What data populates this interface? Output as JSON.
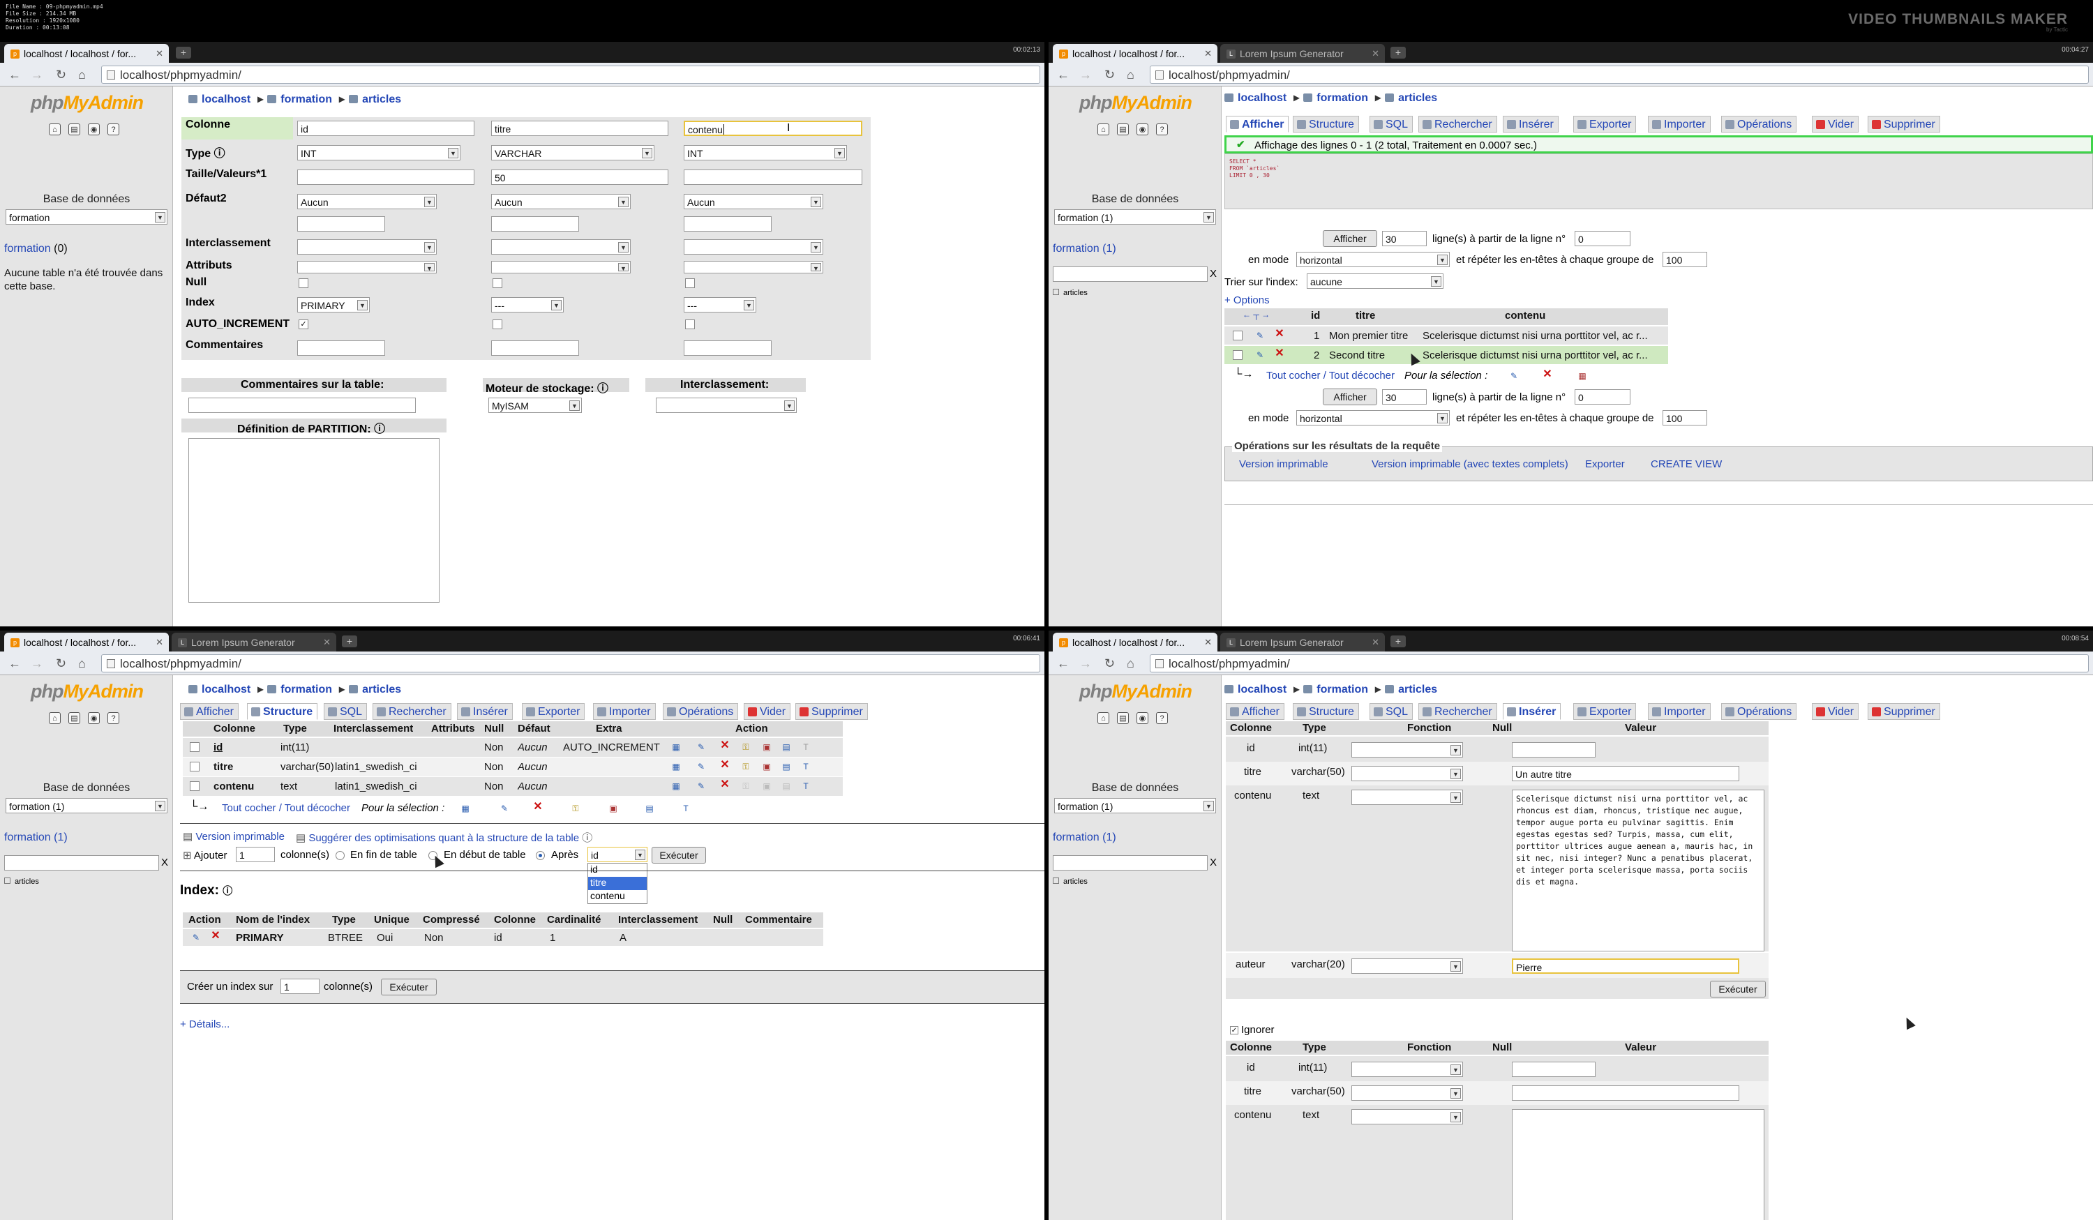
{
  "file_meta": [
    "File Name   : 09-phpmyadmin.mp4",
    "File Size   : 214.34 MB",
    "Resolution  : 1920x1080",
    "Duration    : 00:13:08"
  ],
  "watermark": {
    "title": "VIDEO THUMBNAILS MAKER",
    "sub": "by Tactic"
  },
  "common": {
    "url": "localhost/phpmyadmin/",
    "tab_main": "localhost / localhost / for...",
    "tab_lorem": "Lorem Ipsum Generator",
    "logo_php": "php",
    "logo_my": "MyAdmin",
    "base_label": "Base de données",
    "crumb_server": "localhost",
    "crumb_db": "formation",
    "crumb_table": "articles",
    "nav_tabs": [
      "Afficher",
      "Structure",
      "SQL",
      "Rechercher",
      "Insérer",
      "Exporter",
      "Importer",
      "Opérations",
      "Vider",
      "Supprimer"
    ]
  },
  "p1": {
    "time": "00:02:13",
    "db_select": "formation",
    "db_link": "formation",
    "db_count": "(0)",
    "no_table": "Aucune table n'a été trouvée dans cette base.",
    "labels": {
      "colonne": "Colonne",
      "type": "Type",
      "taille": "Taille/Valeurs*1",
      "defaut": "Défaut2",
      "interclassement": "Interclassement",
      "attributs": "Attributs",
      "null": "Null",
      "index": "Index",
      "auto": "AUTO_INCREMENT",
      "commentaires": "Commentaires"
    },
    "columns": [
      {
        "name": "id",
        "type": "INT",
        "size": "",
        "default": "Aucun",
        "index": "PRIMARY",
        "auto": true
      },
      {
        "name": "titre",
        "type": "VARCHAR",
        "size": "50",
        "default": "Aucun",
        "index": "---",
        "auto": false
      },
      {
        "name": "contenu",
        "type": "INT",
        "size": "",
        "default": "Aucun",
        "index": "---",
        "auto": false
      }
    ],
    "table_comments_label": "Commentaires sur la table:",
    "engine_label": "Moteur de stockage:",
    "engine_value": "MyISAM",
    "collation_label": "Interclassement:",
    "partition_label": "Définition de PARTITION:"
  },
  "p2": {
    "time": "00:04:27",
    "db_select": "formation (1)",
    "db_link": "formation (1)",
    "side_table": "articles",
    "success": "Affichage des lignes 0 - 1 (2 total, Traitement en 0.0007 sec.)",
    "sql": "SELECT *\nFROM `articles`\nLIMIT 0 , 30",
    "afficher_btn": "Afficher",
    "rows_count": "30",
    "from_label": "ligne(s) à partir de la ligne n°",
    "from_value": "0",
    "mode_label": "en mode",
    "mode_value": "horizontal",
    "repeat_label": "et répéter les en-têtes à chaque groupe de",
    "repeat_value": "100",
    "sort_label": "Trier sur l'index:",
    "sort_value": "aucune",
    "options_link": "+ Options",
    "grid_headers": [
      "id",
      "titre",
      "contenu"
    ],
    "rows": [
      {
        "id": "1",
        "titre": "Mon premier titre",
        "contenu": "Scelerisque dictumst nisi urna porttitor vel, ac r..."
      },
      {
        "id": "2",
        "titre": "Second titre",
        "contenu": "Scelerisque dictumst nisi urna porttitor vel, ac r..."
      }
    ],
    "check_all": "Tout cocher / Tout décocher",
    "for_selection": "Pour la sélection :",
    "ops_title": "Opérations sur les résultats de la requête",
    "ops": [
      "Version imprimable",
      "Version imprimable (avec textes complets)",
      "Exporter",
      "CREATE VIEW"
    ]
  },
  "p3": {
    "time": "00:06:41",
    "db_select": "formation (1)",
    "db_link": "formation (1)",
    "side_table": "articles",
    "headers": [
      "Colonne",
      "Type",
      "Interclassement",
      "Attributs",
      "Null",
      "Défaut",
      "Extra",
      "Action"
    ],
    "rows": [
      {
        "col": "id",
        "type": "int(11)",
        "coll": "",
        "attr": "",
        "null": "Non",
        "def": "Aucun",
        "extra": "AUTO_INCREMENT"
      },
      {
        "col": "titre",
        "type": "varchar(50)",
        "coll": "latin1_swedish_ci",
        "attr": "",
        "null": "Non",
        "def": "Aucun",
        "extra": ""
      },
      {
        "col": "contenu",
        "type": "text",
        "coll": "latin1_swedish_ci",
        "attr": "",
        "null": "Non",
        "def": "Aucun",
        "extra": ""
      }
    ],
    "check_all": "Tout cocher / Tout décocher",
    "for_selection": "Pour la sélection :",
    "print_link": "Version imprimable",
    "suggest_link": "Suggérer des optimisations quant à la structure de la table",
    "add_label": "Ajouter",
    "add_value": "1",
    "cols_label": "colonne(s)",
    "end_label": "En fin de table",
    "start_label": "En début de table",
    "after_label": "Après",
    "after_value": "id",
    "after_options": [
      "id",
      "titre",
      "contenu"
    ],
    "exec_btn": "Exécuter",
    "index_title": "Index:",
    "index_headers": [
      "Action",
      "Nom de l'index",
      "Type",
      "Unique",
      "Compressé",
      "Colonne",
      "Cardinalité",
      "Interclassement",
      "Null",
      "Commentaire"
    ],
    "index_row": [
      "PRIMARY",
      "BTREE",
      "Oui",
      "Non",
      "id",
      "1",
      "A",
      ""
    ],
    "create_index": "Créer un index sur",
    "create_value": "1",
    "create_cols": "colonne(s)",
    "details": "+ Détails..."
  },
  "p4": {
    "time": "00:08:54",
    "db_select": "formation (1)",
    "db_link": "formation (1)",
    "side_table": "articles",
    "headers": [
      "Colonne",
      "Type",
      "Fonction",
      "Null",
      "Valeur"
    ],
    "rows": [
      {
        "col": "id",
        "type": "int(11)",
        "value": ""
      },
      {
        "col": "titre",
        "type": "varchar(50)",
        "value": "Un autre titre"
      },
      {
        "col": "contenu",
        "type": "text",
        "value": "Scelerisque dictumst nisi urna porttitor vel, ac rhoncus est diam, rhoncus, tristique nec augue, tempor augue porta eu pulvinar sagittis. Enim egestas egestas sed? Turpis, massa, cum elit, porttitor ultrices augue aenean a, mauris hac, in sit nec, nisi integer? Nunc a penatibus placerat, et integer porta scelerisque massa, porta sociis dis et magna."
      },
      {
        "col": "auteur",
        "type": "varchar(20)",
        "value": "Pierre"
      }
    ],
    "exec_btn": "Exécuter",
    "ignore_label": "Ignorer",
    "rows2": [
      {
        "col": "id",
        "type": "int(11)"
      },
      {
        "col": "titre",
        "type": "varchar(50)"
      },
      {
        "col": "contenu",
        "type": "text"
      }
    ]
  }
}
